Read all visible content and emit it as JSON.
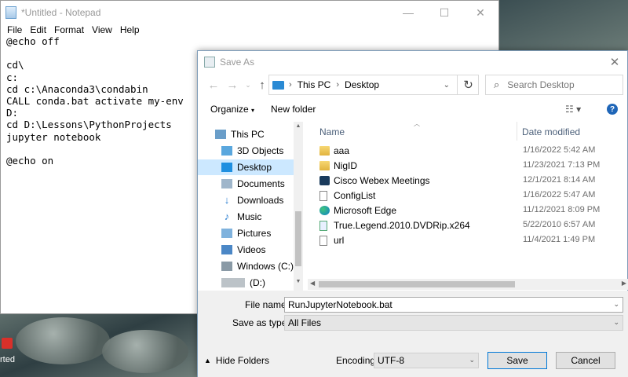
{
  "notepad": {
    "title": "*Untitled - Notepad",
    "menu": [
      "File",
      "Edit",
      "Format",
      "View",
      "Help"
    ],
    "content": "@echo off\n\ncd\\\nc:\ncd c:\\Anaconda3\\condabin\nCALL conda.bat activate my-env\nD:\ncd D:\\Lessons\\PythonProjects\njupyter notebook\n\n@echo on"
  },
  "dialog": {
    "title": "Save As",
    "address": {
      "root": "This PC",
      "current": "Desktop"
    },
    "search_placeholder": "Search Desktop",
    "toolbar": {
      "organize": "Organize",
      "new_folder": "New folder",
      "help": "?"
    },
    "tree": [
      {
        "label": "This PC",
        "icon": "pc-icon"
      },
      {
        "label": "3D Objects",
        "icon": "cube-icon"
      },
      {
        "label": "Desktop",
        "icon": "desktop-icon",
        "selected": true
      },
      {
        "label": "Documents",
        "icon": "documents-icon"
      },
      {
        "label": "Downloads",
        "icon": "download-icon"
      },
      {
        "label": "Music",
        "icon": "music-icon"
      },
      {
        "label": "Pictures",
        "icon": "pictures-icon"
      },
      {
        "label": "Videos",
        "icon": "videos-icon"
      },
      {
        "label": "Windows (C:)",
        "icon": "drive-icon"
      },
      {
        "label": "(D:)",
        "icon": "drive-icon"
      }
    ],
    "columns": {
      "name": "Name",
      "date": "Date modified"
    },
    "files": [
      {
        "name": "aaa",
        "date": "1/16/2022 5:42 AM",
        "icon": "folder-icon"
      },
      {
        "name": "NigID",
        "date": "11/23/2021 7:13 PM",
        "icon": "folder-icon"
      },
      {
        "name": "Cisco Webex Meetings",
        "date": "12/1/2021 8:14 AM",
        "icon": "webex-icon"
      },
      {
        "name": "ConfigList",
        "date": "1/16/2022 5:47 AM",
        "icon": "document-icon"
      },
      {
        "name": "Microsoft Edge",
        "date": "11/12/2021 8:09 PM",
        "icon": "edge-icon"
      },
      {
        "name": "True.Legend.2010.DVDRip.x264",
        "date": "5/22/2010 6:57 AM",
        "icon": "video-file-icon"
      },
      {
        "name": "url",
        "date": "11/4/2021 1:49 PM",
        "icon": "document-icon"
      }
    ],
    "file_name_label": "File name:",
    "file_name_value": "RunJupyterNotebook.bat",
    "save_as_type_label": "Save as type:",
    "save_as_type_value": "All Files",
    "hide_folders": "Hide Folders",
    "encoding_label": "Encoding:",
    "encoding_value": "UTF-8",
    "save_button": "Save",
    "cancel_button": "Cancel"
  },
  "desktop": {
    "partial_text": "rted"
  }
}
